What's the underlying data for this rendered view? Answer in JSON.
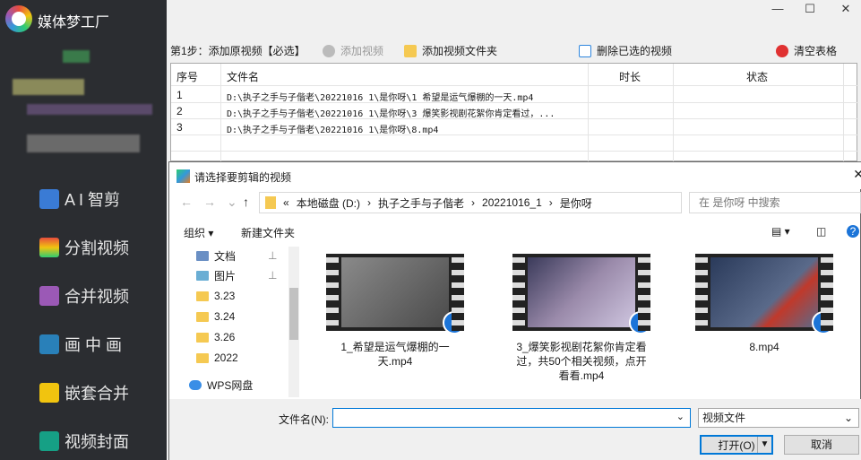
{
  "app": {
    "title": "媒体梦工厂"
  },
  "sidebar": {
    "items": [
      {
        "label": "A I 智剪",
        "icon": "ai-clip-icon",
        "color": "#3a7bd5"
      },
      {
        "label": "分割视频",
        "icon": "split-video-icon",
        "color": "#e74c3c"
      },
      {
        "label": "合并视频",
        "icon": "merge-video-icon",
        "color": "#9b59b6"
      },
      {
        "label": "画 中 画",
        "icon": "picture-in-picture-icon",
        "color": "#2980b9"
      },
      {
        "label": "嵌套合并",
        "icon": "nest-merge-icon",
        "color": "#f1c40f"
      },
      {
        "label": "视频封面",
        "icon": "video-cover-icon",
        "color": "#16a085"
      }
    ]
  },
  "window": {
    "minimize": "—",
    "maximize": "☐",
    "close": "✕"
  },
  "toolbar": {
    "step": "第1步：添加原视频【必选】",
    "add_video": "添加视频",
    "add_folder": "添加视频文件夹",
    "delete_selected": "删除已选的视频",
    "clear_table": "清空表格"
  },
  "table": {
    "headers": [
      "序号",
      "文件名",
      "时长",
      "状态"
    ],
    "rows": [
      {
        "index": "1",
        "file": "D:\\执子之手与子偕老\\20221016_1\\是你呀\\1_希望是运气爆棚的一天.mp4"
      },
      {
        "index": "2",
        "file": "D:\\执子之手与子偕老\\20221016_1\\是你呀\\3_爆笑影视剧花絮你肯定看过，..."
      },
      {
        "index": "3",
        "file": "D:\\执子之手与子偕老\\20221016_1\\是你呀\\8.mp4"
      }
    ]
  },
  "dialog": {
    "title": "请选择要剪辑的视频",
    "close": "✕",
    "nav": {
      "back": "←",
      "forward": "→",
      "dropdown": "⌄",
      "up": "↑"
    },
    "address": [
      "«",
      "本地磁盘 (D:)",
      "›",
      "执子之手与子偕老",
      "›",
      "20221016_1",
      "›",
      "是你呀"
    ],
    "search_placeholder": "在 是你呀 中搜索",
    "organize": "组织 ▾",
    "new_folder": "新建文件夹",
    "tree": [
      {
        "label": "文档",
        "type": "doc"
      },
      {
        "label": "图片",
        "type": "pic"
      },
      {
        "label": "3.23",
        "type": "folder"
      },
      {
        "label": "3.24",
        "type": "folder"
      },
      {
        "label": "3.26",
        "type": "folder"
      },
      {
        "label": "2022",
        "type": "folder"
      },
      {
        "label": "WPS网盘",
        "type": "cloud"
      }
    ],
    "files": [
      {
        "name": "1_希望是运气爆棚的一天.mp4",
        "color": "#6b6b6b"
      },
      {
        "name": "3_爆笑影视剧花絮你肯定看过，共50个相关视频，点开看看.mp4",
        "color": "#7a6a9a"
      },
      {
        "name": "8.mp4",
        "color": "#4a5a7a"
      }
    ],
    "filename_label": "文件名(N):",
    "filename_value": "",
    "filter": "视频文件",
    "open": "打开(O)",
    "cancel": "取消"
  }
}
